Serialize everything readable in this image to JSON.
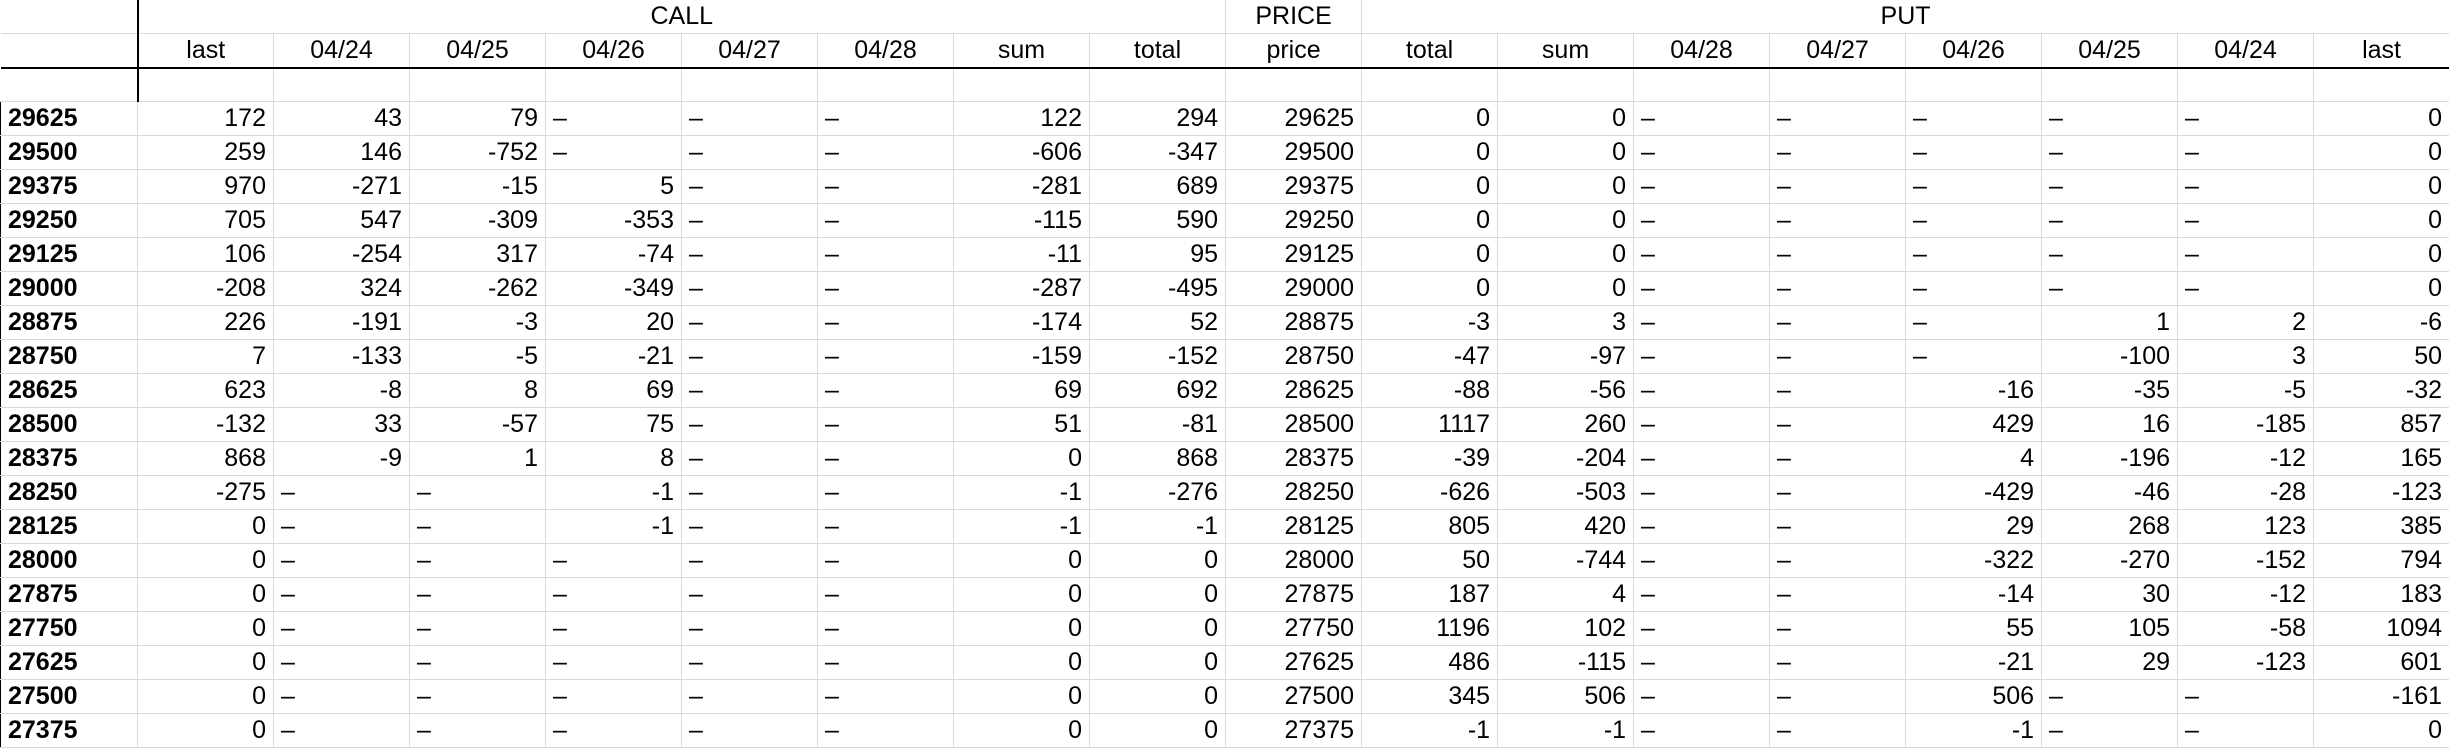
{
  "groups": {
    "call": "CALL",
    "price": "PRICE",
    "put": "PUT"
  },
  "columns": [
    "last",
    "04/24",
    "04/25",
    "04/26",
    "04/27",
    "04/28",
    "sum",
    "total",
    "price",
    "total",
    "sum",
    "04/28",
    "04/27",
    "04/26",
    "04/25",
    "04/24",
    "last"
  ],
  "rows": [
    [
      "29625",
      "172",
      "43",
      "79",
      "–",
      "–",
      "–",
      "122",
      "294",
      "29625",
      "0",
      "0",
      "–",
      "–",
      "–",
      "–",
      "–",
      "0"
    ],
    [
      "29500",
      "259",
      "146",
      "-752",
      "–",
      "–",
      "–",
      "-606",
      "-347",
      "29500",
      "0",
      "0",
      "–",
      "–",
      "–",
      "–",
      "–",
      "0"
    ],
    [
      "29375",
      "970",
      "-271",
      "-15",
      "5",
      "–",
      "–",
      "-281",
      "689",
      "29375",
      "0",
      "0",
      "–",
      "–",
      "–",
      "–",
      "–",
      "0"
    ],
    [
      "29250",
      "705",
      "547",
      "-309",
      "-353",
      "–",
      "–",
      "-115",
      "590",
      "29250",
      "0",
      "0",
      "–",
      "–",
      "–",
      "–",
      "–",
      "0"
    ],
    [
      "29125",
      "106",
      "-254",
      "317",
      "-74",
      "–",
      "–",
      "-11",
      "95",
      "29125",
      "0",
      "0",
      "–",
      "–",
      "–",
      "–",
      "–",
      "0"
    ],
    [
      "29000",
      "-208",
      "324",
      "-262",
      "-349",
      "–",
      "–",
      "-287",
      "-495",
      "29000",
      "0",
      "0",
      "–",
      "–",
      "–",
      "–",
      "–",
      "0"
    ],
    [
      "28875",
      "226",
      "-191",
      "-3",
      "20",
      "–",
      "–",
      "-174",
      "52",
      "28875",
      "-3",
      "3",
      "–",
      "–",
      "–",
      "1",
      "2",
      "-6"
    ],
    [
      "28750",
      "7",
      "-133",
      "-5",
      "-21",
      "–",
      "–",
      "-159",
      "-152",
      "28750",
      "-47",
      "-97",
      "–",
      "–",
      "–",
      "-100",
      "3",
      "50"
    ],
    [
      "28625",
      "623",
      "-8",
      "8",
      "69",
      "–",
      "–",
      "69",
      "692",
      "28625",
      "-88",
      "-56",
      "–",
      "–",
      "-16",
      "-35",
      "-5",
      "-32"
    ],
    [
      "28500",
      "-132",
      "33",
      "-57",
      "75",
      "–",
      "–",
      "51",
      "-81",
      "28500",
      "1117",
      "260",
      "–",
      "–",
      "429",
      "16",
      "-185",
      "857"
    ],
    [
      "28375",
      "868",
      "-9",
      "1",
      "8",
      "–",
      "–",
      "0",
      "868",
      "28375",
      "-39",
      "-204",
      "–",
      "–",
      "4",
      "-196",
      "-12",
      "165"
    ],
    [
      "28250",
      "-275",
      "–",
      "–",
      "-1",
      "–",
      "–",
      "-1",
      "-276",
      "28250",
      "-626",
      "-503",
      "–",
      "–",
      "-429",
      "-46",
      "-28",
      "-123"
    ],
    [
      "28125",
      "0",
      "–",
      "–",
      "-1",
      "–",
      "–",
      "-1",
      "-1",
      "28125",
      "805",
      "420",
      "–",
      "–",
      "29",
      "268",
      "123",
      "385"
    ],
    [
      "28000",
      "0",
      "–",
      "–",
      "–",
      "–",
      "–",
      "0",
      "0",
      "28000",
      "50",
      "-744",
      "–",
      "–",
      "-322",
      "-270",
      "-152",
      "794"
    ],
    [
      "27875",
      "0",
      "–",
      "–",
      "–",
      "–",
      "–",
      "0",
      "0",
      "27875",
      "187",
      "4",
      "–",
      "–",
      "-14",
      "30",
      "-12",
      "183"
    ],
    [
      "27750",
      "0",
      "–",
      "–",
      "–",
      "–",
      "–",
      "0",
      "0",
      "27750",
      "1196",
      "102",
      "–",
      "–",
      "55",
      "105",
      "-58",
      "1094"
    ],
    [
      "27625",
      "0",
      "–",
      "–",
      "–",
      "–",
      "–",
      "0",
      "0",
      "27625",
      "486",
      "-115",
      "–",
      "–",
      "-21",
      "29",
      "-123",
      "601"
    ],
    [
      "27500",
      "0",
      "–",
      "–",
      "–",
      "–",
      "–",
      "0",
      "0",
      "27500",
      "345",
      "506",
      "–",
      "–",
      "506",
      "–",
      "–",
      "-161"
    ],
    [
      "27375",
      "0",
      "–",
      "–",
      "–",
      "–",
      "–",
      "0",
      "0",
      "27375",
      "-1",
      "-1",
      "–",
      "–",
      "-1",
      "–",
      "–",
      "0"
    ]
  ]
}
